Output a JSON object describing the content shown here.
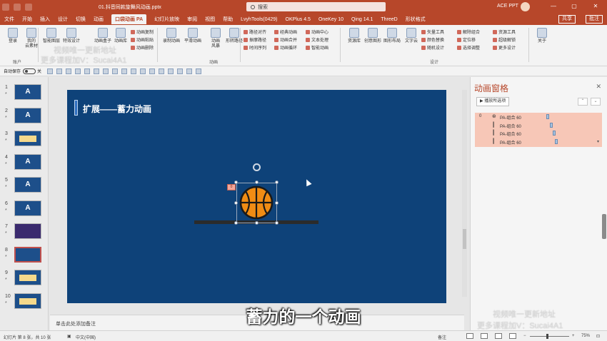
{
  "titlebar": {
    "doc_title": "01.抖音同款旋舞风动画.pptx",
    "search_placeholder": "搜索",
    "user_name": "ACE PPT",
    "minimize": "—",
    "maximize": "▢",
    "close": "✕"
  },
  "menu": {
    "tabs": [
      "文件",
      "开始",
      "插入",
      "设计",
      "切换",
      "动画",
      "口袋动画 PA",
      "幻灯片放映",
      "审阅",
      "视图",
      "帮助",
      "LvyhTools(0429)",
      "OKPlus 4.5",
      "OneKey 10",
      "Qing 14.1",
      "ThreeD",
      "形状格式"
    ],
    "share": "共享",
    "comments": "批注"
  },
  "ribbon": {
    "big_buttons": [
      {
        "label": "登录"
      },
      {
        "label": "我的\n云素材"
      },
      {
        "label": "智能图层"
      },
      {
        "label": "特效设计"
      },
      {
        "label": "动画盒子"
      },
      {
        "label": "动画库"
      },
      {
        "label": "录制动画"
      },
      {
        "label": "平滑动画"
      },
      {
        "label": "动画\n风暴"
      },
      {
        "label": "形转路径"
      },
      {
        "label": "资源库"
      },
      {
        "label": "创意图形"
      },
      {
        "label": "图形布局"
      },
      {
        "label": "文字云"
      },
      {
        "label": "关于"
      }
    ],
    "small_buttons": {
      "col1": [
        "动画复制",
        "动画粘贴",
        "动画删除"
      ],
      "col2": [
        "路径对齐",
        "振摩路径",
        "时间序列"
      ],
      "col3": [
        "经典动画",
        "动画合并",
        "动画循环"
      ],
      "col4": [
        "动画中心",
        "文本处理",
        "智能动画"
      ],
      "col5": [
        "矢量工具",
        "颜色替换",
        "随机设计"
      ],
      "col6": [
        "解除组合",
        "定位移",
        "选择调整"
      ],
      "col7": [
        "资源工具",
        "超级解锁",
        "更多设计"
      ]
    },
    "groups": [
      "账户",
      "动画",
      "设计"
    ]
  },
  "qat": {
    "autosave_label": "自动保存",
    "autosave_state": "关"
  },
  "thumbnails": [
    {
      "num": "1",
      "star": "*",
      "glyph": "A"
    },
    {
      "num": "2",
      "star": "*",
      "glyph": "A"
    },
    {
      "num": "3",
      "star": "*",
      "glyph": ""
    },
    {
      "num": "4",
      "star": "*",
      "glyph": "A"
    },
    {
      "num": "5",
      "star": "*",
      "glyph": "A"
    },
    {
      "num": "6",
      "star": "*",
      "glyph": "A"
    },
    {
      "num": "7",
      "star": "*",
      "glyph": ""
    },
    {
      "num": "8",
      "star": "*",
      "glyph": ""
    },
    {
      "num": "9",
      "star": "*",
      "glyph": ""
    },
    {
      "num": "10",
      "star": "*",
      "glyph": ""
    }
  ],
  "slide": {
    "title": "扩展——蓄力动画",
    "anim_tag": "0"
  },
  "notes_placeholder": "单击此处添加备注",
  "animation_pane": {
    "title": "动画窗格",
    "close": "✕",
    "play_button": "播放所选项",
    "up": "⌃",
    "down": "⌄",
    "items": [
      {
        "idx": "0",
        "name": "PA-组合 60",
        "bar_offset": 0.56
      },
      {
        "idx": "",
        "name": "PA-组合 60",
        "bar_offset": 0.59
      },
      {
        "idx": "",
        "name": "PA-组合 60",
        "bar_offset": 0.61
      },
      {
        "idx": "",
        "name": "PA-组合 60",
        "bar_offset": 0.63
      }
    ]
  },
  "status": {
    "slide_info": "幻灯片 第 8 张，共 10 张",
    "language": "中文(中国)",
    "notes": "备注",
    "zoom": "75%"
  },
  "subtitle": "蓄力的一个动画",
  "watermarks": {
    "top_line1": "视频唯一更新地址",
    "top_line2": "更多课程加V：Sucai4A1",
    "bottom_line1": "视频唯一更新地址",
    "bottom_line2": "更多课程加V：Sucai4A1"
  },
  "colors": {
    "accent": "#b7472a",
    "slide_bg": "#0e4279",
    "basketball": "#f08c14",
    "anim_highlight": "#f7c7b7"
  }
}
